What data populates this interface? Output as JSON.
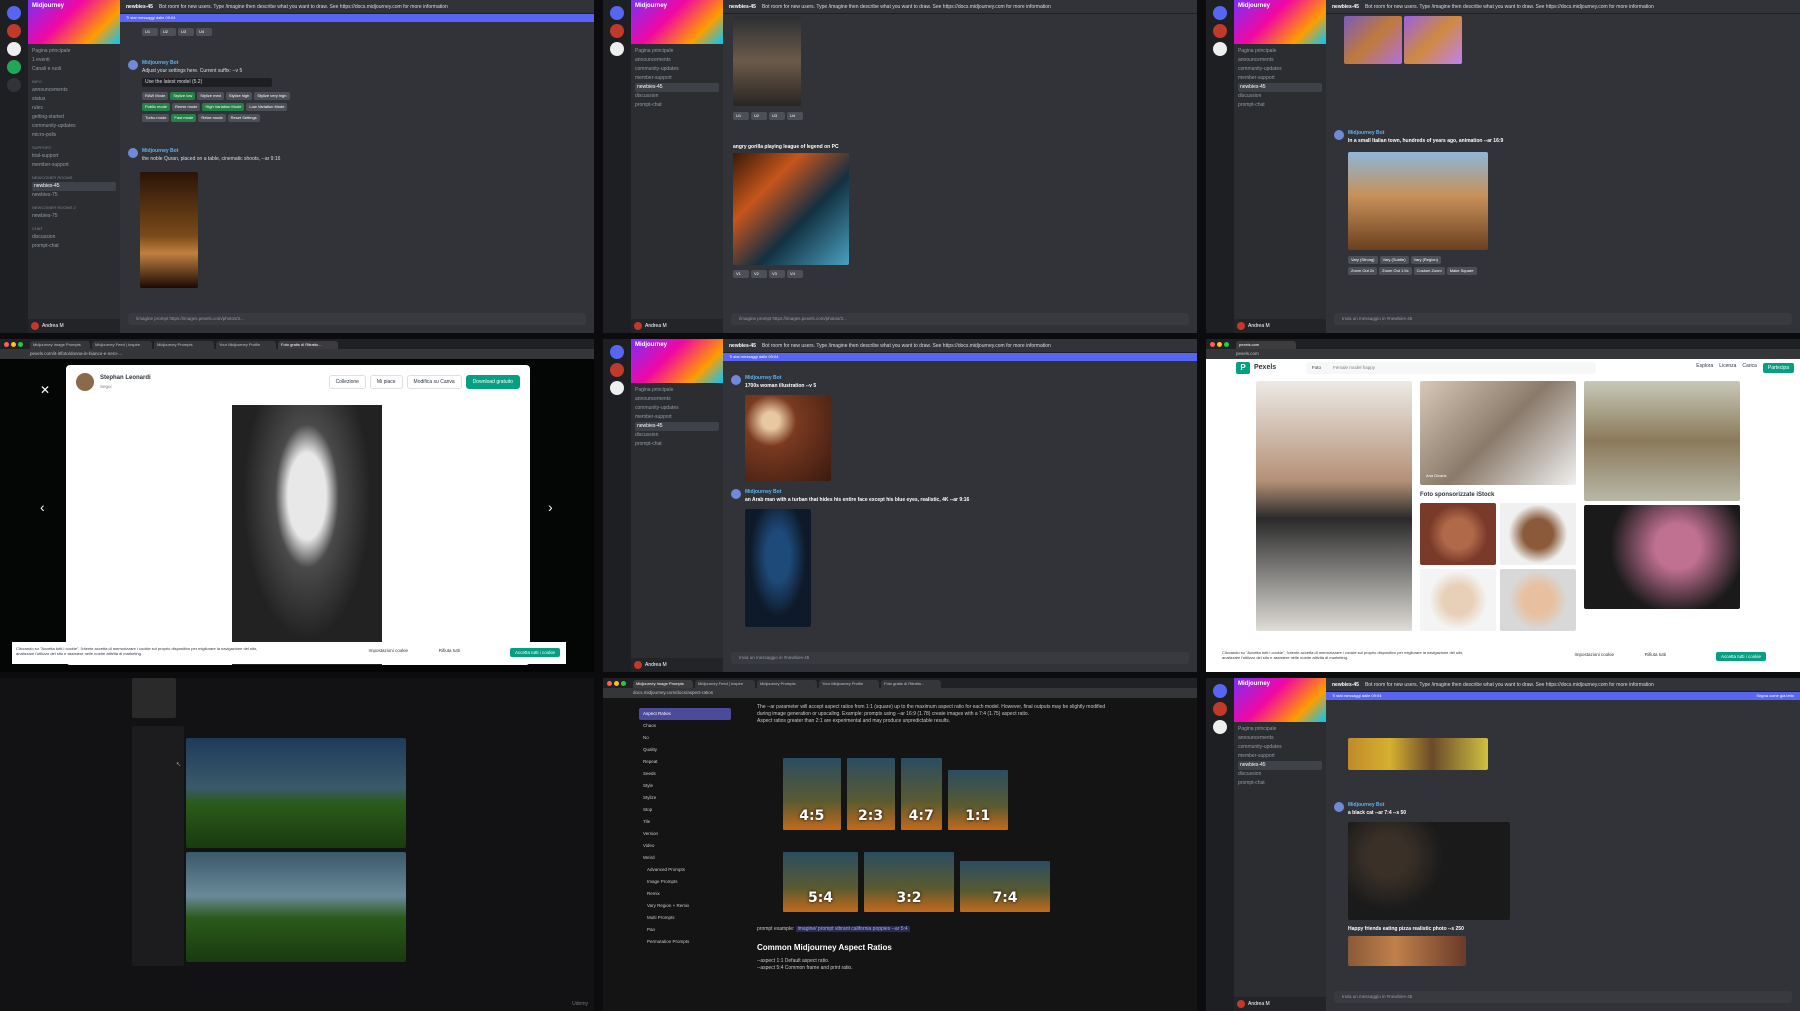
{
  "discord": {
    "server_name": "Midjourney",
    "channel": "newbies-45",
    "topic": "Bot room for new users. Type /imagine then describe what you want to draw. See https://docs.midjourney.com for more information",
    "notice": "Ti stai messaggi dalle 09:04",
    "mark_read": "Segna come già letto",
    "composer_hint": "/imagine  prompt  https://images.pexels.com/photos/3...",
    "user": "Andrea M",
    "bot": "Midjourney Bot",
    "channels": [
      "Pagina principale",
      "1 eventi",
      "Canali e ruoli",
      "INFO",
      "announcements",
      "status",
      "rules",
      "getting-started",
      "community-updates",
      "micro-polls",
      "SUPPORT",
      "trial-support",
      "member-support",
      "NEWCOMER ROOMS",
      "newbies-45",
      "newbies-75",
      "NEWCOMER ROOMS 2",
      "newbies-75",
      "CHAT",
      "discussion",
      "prompt-chat"
    ],
    "settings_text": "Adjust your settings here. Current suffix: --v 5",
    "model_select": "Use the latest model (5.2)",
    "settings_buttons": [
      "RAW Mode",
      "Stylize low",
      "Stylize med",
      "Stylize high",
      "Stylize very high",
      "Public mode",
      "Remix mode",
      "High Variation Mode",
      "Low Variation Mode",
      "Turbo mode",
      "Fast mode",
      "Relax mode",
      "Reset Settings"
    ],
    "quran_prompt": "the noble Quran, placed on a table, cinematic shoots, --ar 9:16",
    "upscale_buttons": [
      "U1",
      "U2",
      "U3",
      "U4",
      "V1",
      "V2",
      "V3",
      "V4"
    ],
    "gorilla_prompt": "angry gorilla playing league of legend on PC",
    "italy_prompt": "In a small Italian town, hundreds of years ago, animation --ar 16:9",
    "zoom_buttons": [
      "Vary (Strong)",
      "Vary (Subtle)",
      "Vary (Region)",
      "Zoom Out 2x",
      "Zoom Out 1.5x",
      "Custom Zoom",
      "Make Square"
    ],
    "woman_prompt": "1700s woman illustration --v 5",
    "arab_prompt": "an Arab man with a turban that hides his entire face except his blue eyes, realistic, 4K --ar 9:16",
    "cat_prompt": "a black cat --ar 7:4 --s 50",
    "friends_prompt": "Happy friends eating pizza realistic photo --s 250",
    "send_hint": "Invia un messaggio in #newbies-45"
  },
  "pexels_modal": {
    "tabs": [
      "Midjourney Image Prompts",
      "Midjourney Feed | Inspire",
      "Midjourney Prompts",
      "Your Midjourney Profile",
      "Foto gratis di Ritratto..."
    ],
    "url": "pexels.com/it-it/foto/donna-in-bianco-e-nero-...",
    "author": "Stephan Leonardi",
    "follow": "Segui",
    "collect": "Collezione",
    "like": "Mi piace",
    "edit": "Modifica su Canva",
    "download": "Download gratuito",
    "cookie_text": "Cliccando su \"Accetta tutti i cookie\", l'utente accetta di memorizzare i cookie sul proprio dispositivo per migliorare la navigazione del sito, analizzare l'utilizzo del sito e assistere nelle nostre attività di marketing.",
    "cookie_settings": "Impostazioni cookie",
    "reject": "Rifiuta tutti",
    "accept": "Accetta tutti i cookie"
  },
  "pexels_grid": {
    "url": "pexels.com",
    "logo": "Pexels",
    "search_type": "Foto",
    "search_placeholder": "Female model happy",
    "nav": [
      "Esplora",
      "Licenza",
      "Carica"
    ],
    "join": "Partecipa",
    "sponsored": "Foto sponsorizzate iStock",
    "contributor": "Ana Divaris"
  },
  "docs": {
    "url": "docs.midjourney.com/docs/aspect-ratios",
    "sidebar": [
      "Aspect Ratios",
      "Chaos",
      "No",
      "Quality",
      "Repeat",
      "Seeds",
      "Style",
      "Stylize",
      "Stop",
      "Tile",
      "Version",
      "Video",
      "Weird",
      "Advanced Prompts",
      "Image Prompts",
      "Remix",
      "Vary Region + Remix",
      "Multi Prompts",
      "Pan",
      "Permutation Prompts"
    ],
    "intro": "The --ar parameter will accept aspect ratios from 1:1 (square) up to the maximum aspect ratio for each model. However, final outputs may be slightly modified during image generation or upscaling. Example: prompts using --ar 16:9 (1.78) create images with a 7:4 (1.75) aspect ratio.",
    "note": "Aspect ratios greater than 2:1 are experimental and may produce unpredictable results.",
    "ratios": [
      "4:5",
      "2:3",
      "4:7",
      "1:1",
      "5:4",
      "3:2",
      "7:4"
    ],
    "prompt_example_label": "prompt example:",
    "prompt_example": "imagine/ prompt vibrant california poppies --ar 5:4",
    "section": "Common Midjourney Aspect Ratios",
    "list": [
      "--aspect 1:1 Default aspect ratio.",
      "--aspect 5:4 Common frame and print ratio."
    ]
  },
  "udemy": "Udemy"
}
